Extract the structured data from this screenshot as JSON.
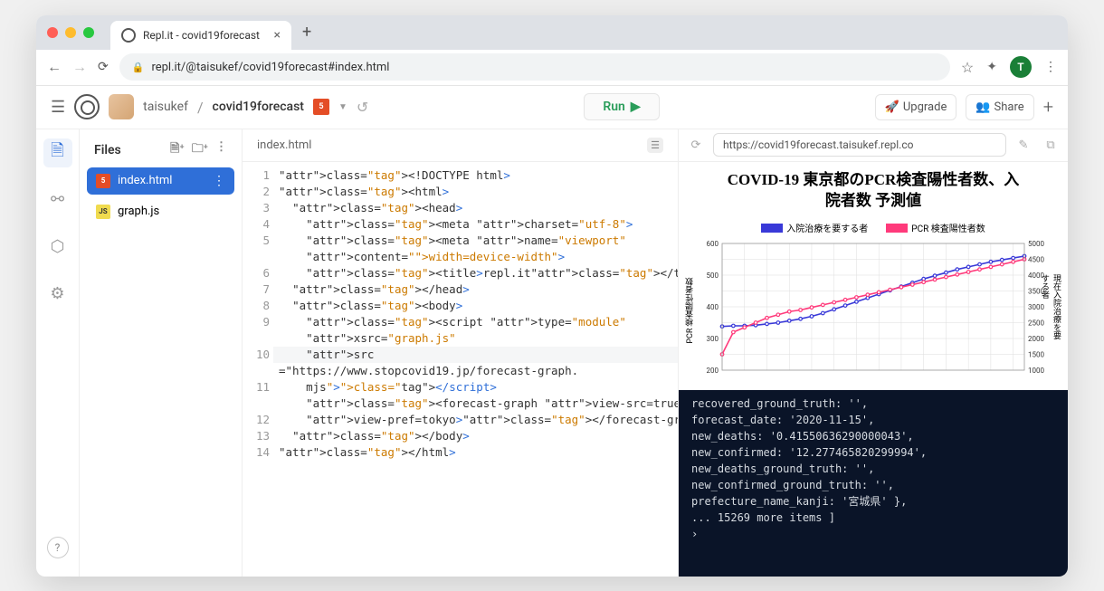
{
  "browser": {
    "tab_title": "Repl.it - covid19forecast",
    "url": "repl.it/@taisukef/covid19forecast#index.html",
    "avatar_letter": "T"
  },
  "repl": {
    "username": "taisukef",
    "reponame": "covid19forecast",
    "run": "Run",
    "upgrade": "Upgrade",
    "share": "Share"
  },
  "files": {
    "header": "Files",
    "active": "index.html",
    "other": "graph.js"
  },
  "editor": {
    "tab": "index.html",
    "gutter": [
      "1",
      "2",
      "3",
      "4",
      "5",
      "6",
      "7",
      "8",
      "9",
      "10",
      "",
      "11",
      "",
      "12",
      "13",
      "14"
    ],
    "code_lines": [
      "<!DOCTYPE html>",
      "<html>",
      "  <head>",
      "    <meta charset=\"utf-8\">",
      "    <meta name=\"viewport\" content=\"width=device-width\">",
      "    <title>repl.it</title>",
      "  </head>",
      "  <body>",
      "    <script type=\"module\" xsrc=\"graph.js\" src=\"https://www.stopcovid19.jp/forecast-graph.mjs\"></script>",
      "    <forecast-graph view-src=true view-pref=tokyo></forecast-graph>",
      "  </body>",
      "</html>"
    ]
  },
  "preview": {
    "url": "https://covid19forecast.taisukef.repl.co",
    "title_line1": "COVID-19 東京都のPCR検査陽性者数、入",
    "title_line2": "院者数 予測値",
    "legend1": "入院治療を要する者",
    "legend2": "PCR 検査陽性者数",
    "y1_label": "PCR 検査陽性者数",
    "y2_label": "現在入院治療を要する者"
  },
  "chart_data": {
    "type": "line",
    "x_count": 28,
    "y1_ticks": [
      200,
      300,
      400,
      500,
      600
    ],
    "y2_ticks": [
      1000,
      1500,
      2000,
      2500,
      3000,
      3500,
      4000,
      4500,
      5000
    ],
    "series": [
      {
        "name": "入院治療を要する者",
        "color": "#3939d8",
        "axis": "y1",
        "values": [
          338,
          340,
          340,
          342,
          346,
          350,
          356,
          362,
          370,
          380,
          392,
          404,
          416,
          428,
          440,
          452,
          464,
          476,
          488,
          498,
          508,
          518,
          526,
          534,
          542,
          548,
          554,
          560
        ]
      },
      {
        "name": "PCR 検査陽性者数",
        "color": "#ff3a7b",
        "axis": "y2",
        "values": [
          1500,
          2200,
          2350,
          2500,
          2650,
          2750,
          2850,
          2900,
          2980,
          3060,
          3140,
          3220,
          3300,
          3380,
          3460,
          3540,
          3620,
          3700,
          3780,
          3860,
          3940,
          4020,
          4100,
          4180,
          4260,
          4340,
          4420,
          4500
        ]
      }
    ]
  },
  "console": {
    "lines": [
      "  recovered_ground_truth: '',",
      "  forecast_date: '2020-11-15',",
      "  new_deaths: '0.41550636290000043',",
      "  new_confirmed: '12.277465820299994',",
      "  new_deaths_ground_truth: '',",
      "  new_confirmed_ground_truth: '',",
      "  prefecture_name_kanji: '宮城県' },",
      "... 15269 more items ]"
    ]
  }
}
